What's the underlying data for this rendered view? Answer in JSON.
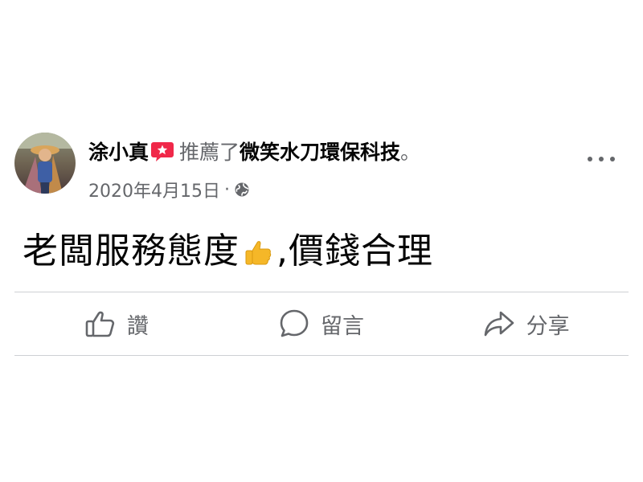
{
  "post": {
    "author": "涂小真",
    "verb": "推薦了",
    "page_name": "微笑水刀環保科技",
    "period": "。",
    "date": "2020年4月15日",
    "separator": "·",
    "privacy_icon": "globe-icon",
    "text_before_emoji": "老闆服務態度",
    "emoji": "thumbs-up-emoji",
    "text_after_emoji": ",價錢合理"
  },
  "actions": {
    "like_label": "讚",
    "comment_label": "留言",
    "share_label": "分享"
  },
  "colors": {
    "recommend_badge": "#f02849",
    "secondary_text": "#65676b",
    "divider": "#ced0d4",
    "emoji_yellow": "#f5b728"
  }
}
